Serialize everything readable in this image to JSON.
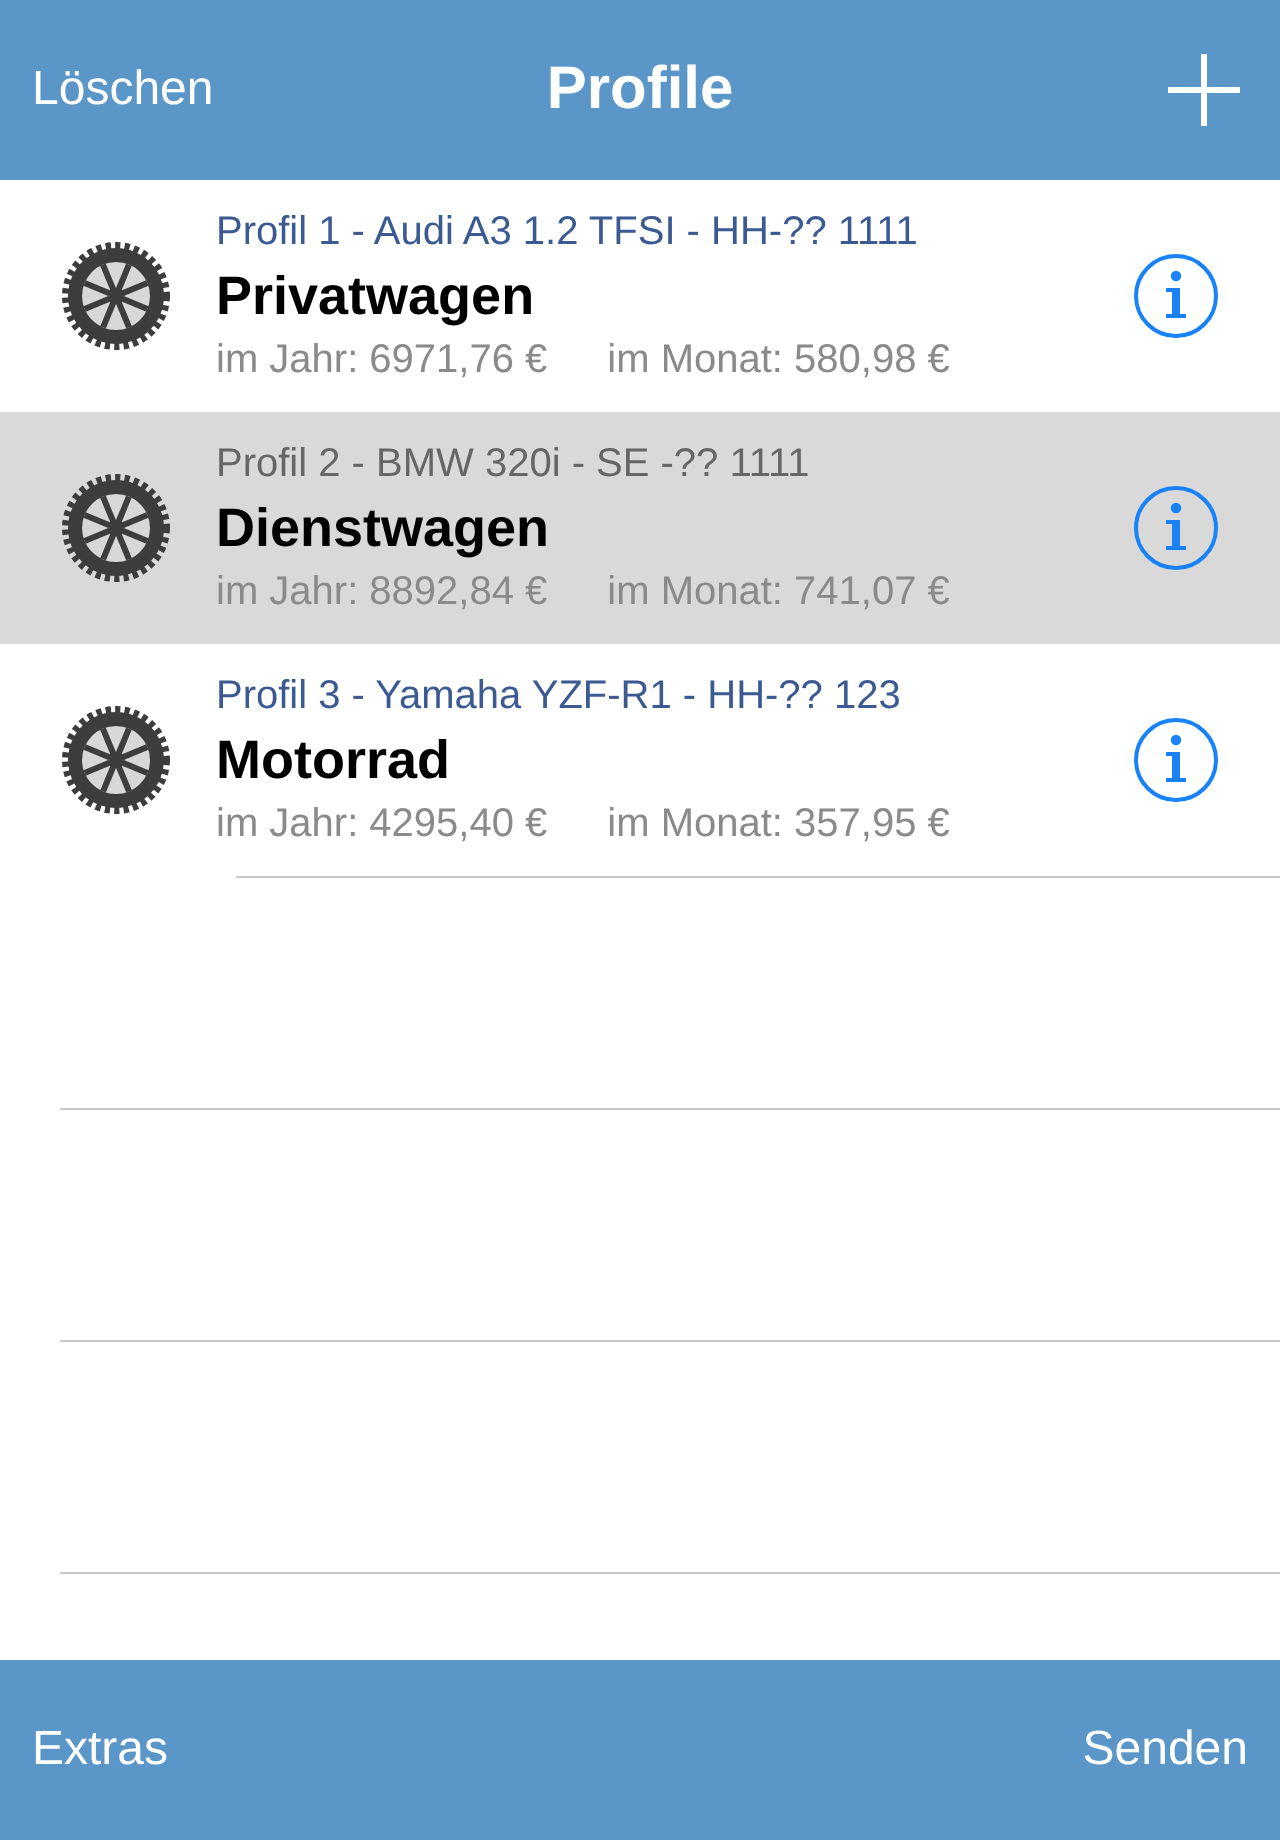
{
  "nav_bar": {
    "left_button": "Löschen",
    "title": "Profile"
  },
  "profiles": [
    {
      "subtitle": "Profil 1 - Audi A3 1.2 TFSI - HH-?? 1111",
      "name": "Privatwagen",
      "yearly": "im Jahr: 6971,76 €",
      "monthly": "im Monat: 580,98 €",
      "selected": false
    },
    {
      "subtitle": "Profil 2 - BMW 320i - SE -?? 1111",
      "name": "Dienstwagen",
      "yearly": "im Jahr: 8892,84 €",
      "monthly": "im Monat: 741,07 €",
      "selected": true
    },
    {
      "subtitle": "Profil 3 - Yamaha YZF-R1 - HH-?? 123",
      "name": "Motorrad",
      "yearly": "im Jahr: 4295,40 €",
      "monthly": "im Monat: 357,95 €",
      "selected": false
    }
  ],
  "toolbar": {
    "left_button": "Extras",
    "right_button": "Senden"
  }
}
